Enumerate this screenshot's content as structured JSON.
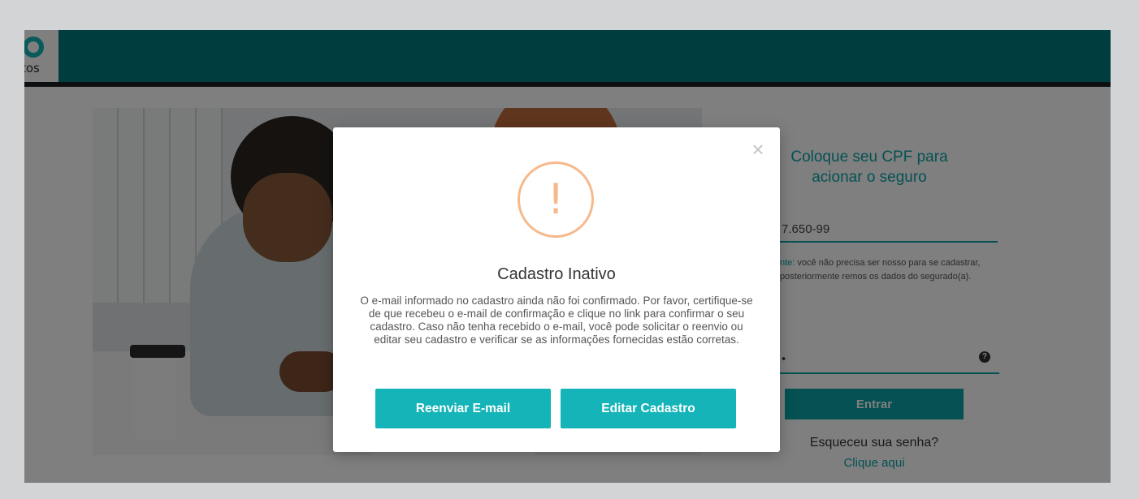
{
  "header": {
    "logo_text": "tos"
  },
  "login": {
    "title": "Coloque seu CPF para acionar o seguro",
    "cpf_value": "7.650-99",
    "hint_accent": "nte:",
    "hint_text": " você não precisa ser nosso para se cadastrar, posteriormente remos os dados do segurado(a).",
    "password_value": "•",
    "help_icon": "?",
    "submit_label": "Entrar",
    "forgot_text": "Esqueceu sua senha?",
    "forgot_link": "Clique aqui"
  },
  "modal": {
    "close_icon": "×",
    "warning_icon": "!",
    "warning_color": "#f6b98c",
    "title": "Cadastro Inativo",
    "body": "O e-mail informado no cadastro ainda não foi confirmado. Por favor, certifique-se de que recebeu o e-mail de confirmação e clique no link para confirmar o seu cadastro. Caso não tenha recebido o e-mail, você pode solicitar o reenvio ou editar seu cadastro e verificar se as informações fornecidas estão corretas.",
    "resend_label": "Reenviar E-mail",
    "edit_label": "Editar Cadastro"
  },
  "colors": {
    "brand_teal": "#007a7c",
    "accent": "#15b4b8"
  }
}
